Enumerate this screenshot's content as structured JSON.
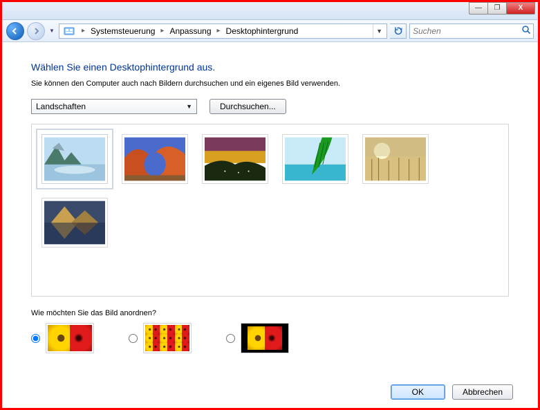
{
  "window": {
    "minimize": "—",
    "maximize": "❐",
    "close": "X"
  },
  "breadcrumb": {
    "root_chevron": "▸",
    "seg1": "Systemsteuerung",
    "seg2": "Anpassung",
    "seg3": "Desktophintergrund"
  },
  "search": {
    "placeholder": "Suchen"
  },
  "heading": "Wählen Sie einen Desktophintergrund aus.",
  "subtext": "Sie können den Computer auch nach Bildern durchsuchen und ein eigenes Bild verwenden.",
  "category_dropdown": {
    "selected": "Landschaften"
  },
  "browse_button": "Durchsuchen...",
  "thumbnails": [
    {
      "name": "landscape-lake-mountains",
      "selected": true
    },
    {
      "name": "landscape-red-rock-arch",
      "selected": false
    },
    {
      "name": "landscape-sunset-hills",
      "selected": false
    },
    {
      "name": "landscape-palm-leaf-ocean",
      "selected": false
    },
    {
      "name": "landscape-wheat-sunrise",
      "selected": false
    },
    {
      "name": "landscape-mountain-reflection",
      "selected": false
    }
  ],
  "arrange_question": "Wie möchten Sie das Bild anordnen?",
  "arrange_options": [
    {
      "value": "fill",
      "checked": true
    },
    {
      "value": "tile",
      "checked": false
    },
    {
      "value": "center",
      "checked": false
    }
  ],
  "footer": {
    "ok": "OK",
    "cancel": "Abbrechen"
  }
}
